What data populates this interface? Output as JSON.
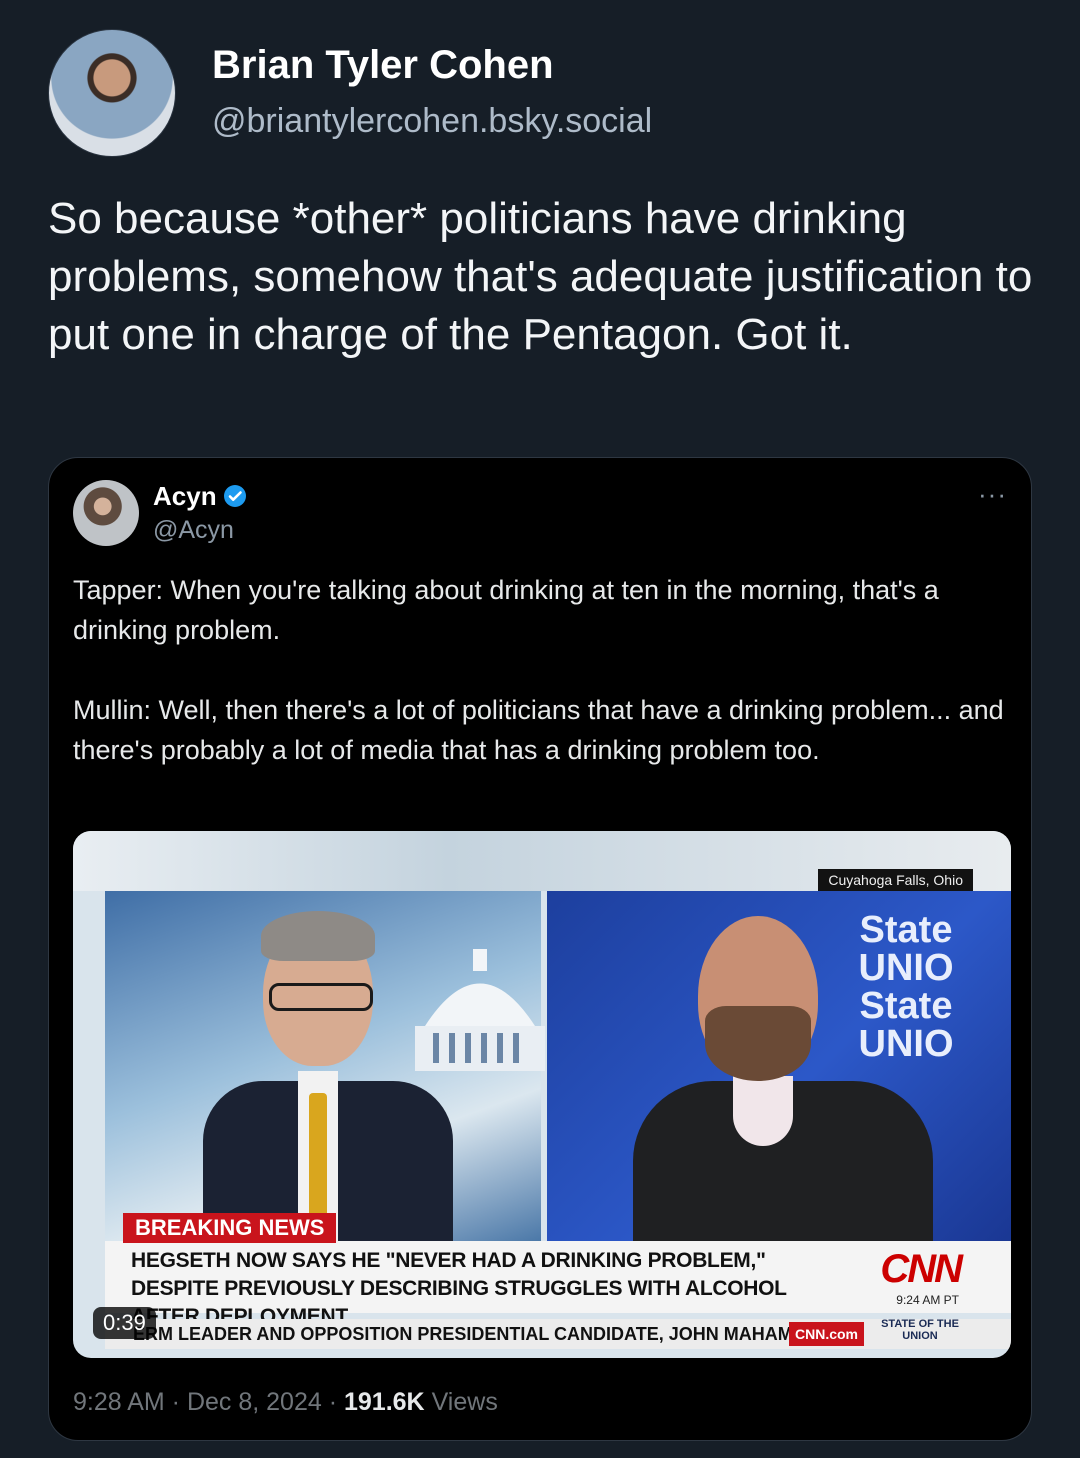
{
  "post": {
    "author_name": "Brian Tyler Cohen",
    "author_handle": "@briantylercohen.bsky.social",
    "text": "So because *other* politicians have drinking problems, somehow that's adequate justification to put one in charge of the Pentagon. Got it."
  },
  "embed": {
    "author_name": "Acyn",
    "author_handle": "@Acyn",
    "more": "···",
    "text": "Tapper: When you're talking about drinking at ten in the morning, that's a drinking problem.\n\nMullin: Well, then there's a lot of politicians that have a drinking problem... and there's probably a lot of media that has a drinking problem too.",
    "video": {
      "location": "Cuyahoga Falls, Ohio",
      "brand_text": "State\nUNIO\nState\nUNIO",
      "breaking_label": "BREAKING NEWS",
      "headline": "HEGSETH NOW SAYS HE \"NEVER HAD A DRINKING PROBLEM,\" DESPITE PREVIOUSLY DESCRIBING STRUGGLES WITH ALCOHOL AFTER DEPLOYMENT",
      "cnn_logo": "CNN",
      "cnn_time": "9:24 AM PT",
      "ticker": "ERM LEADER AND OPPOSITION PRESIDENTIAL CANDIDATE, JOHN MAHAMA.",
      "cnn_com": "CNN.com",
      "show_name": "STATE OF THE UNION",
      "duration": "0:39"
    },
    "time": "9:28 AM",
    "date": "Dec 8, 2024",
    "separator": " · ",
    "views_count": "191.6K",
    "views_label": "Views"
  },
  "colors": {
    "background": "#161e27",
    "verified_blue": "#1d9bf0",
    "cnn_red": "#cc0000"
  }
}
